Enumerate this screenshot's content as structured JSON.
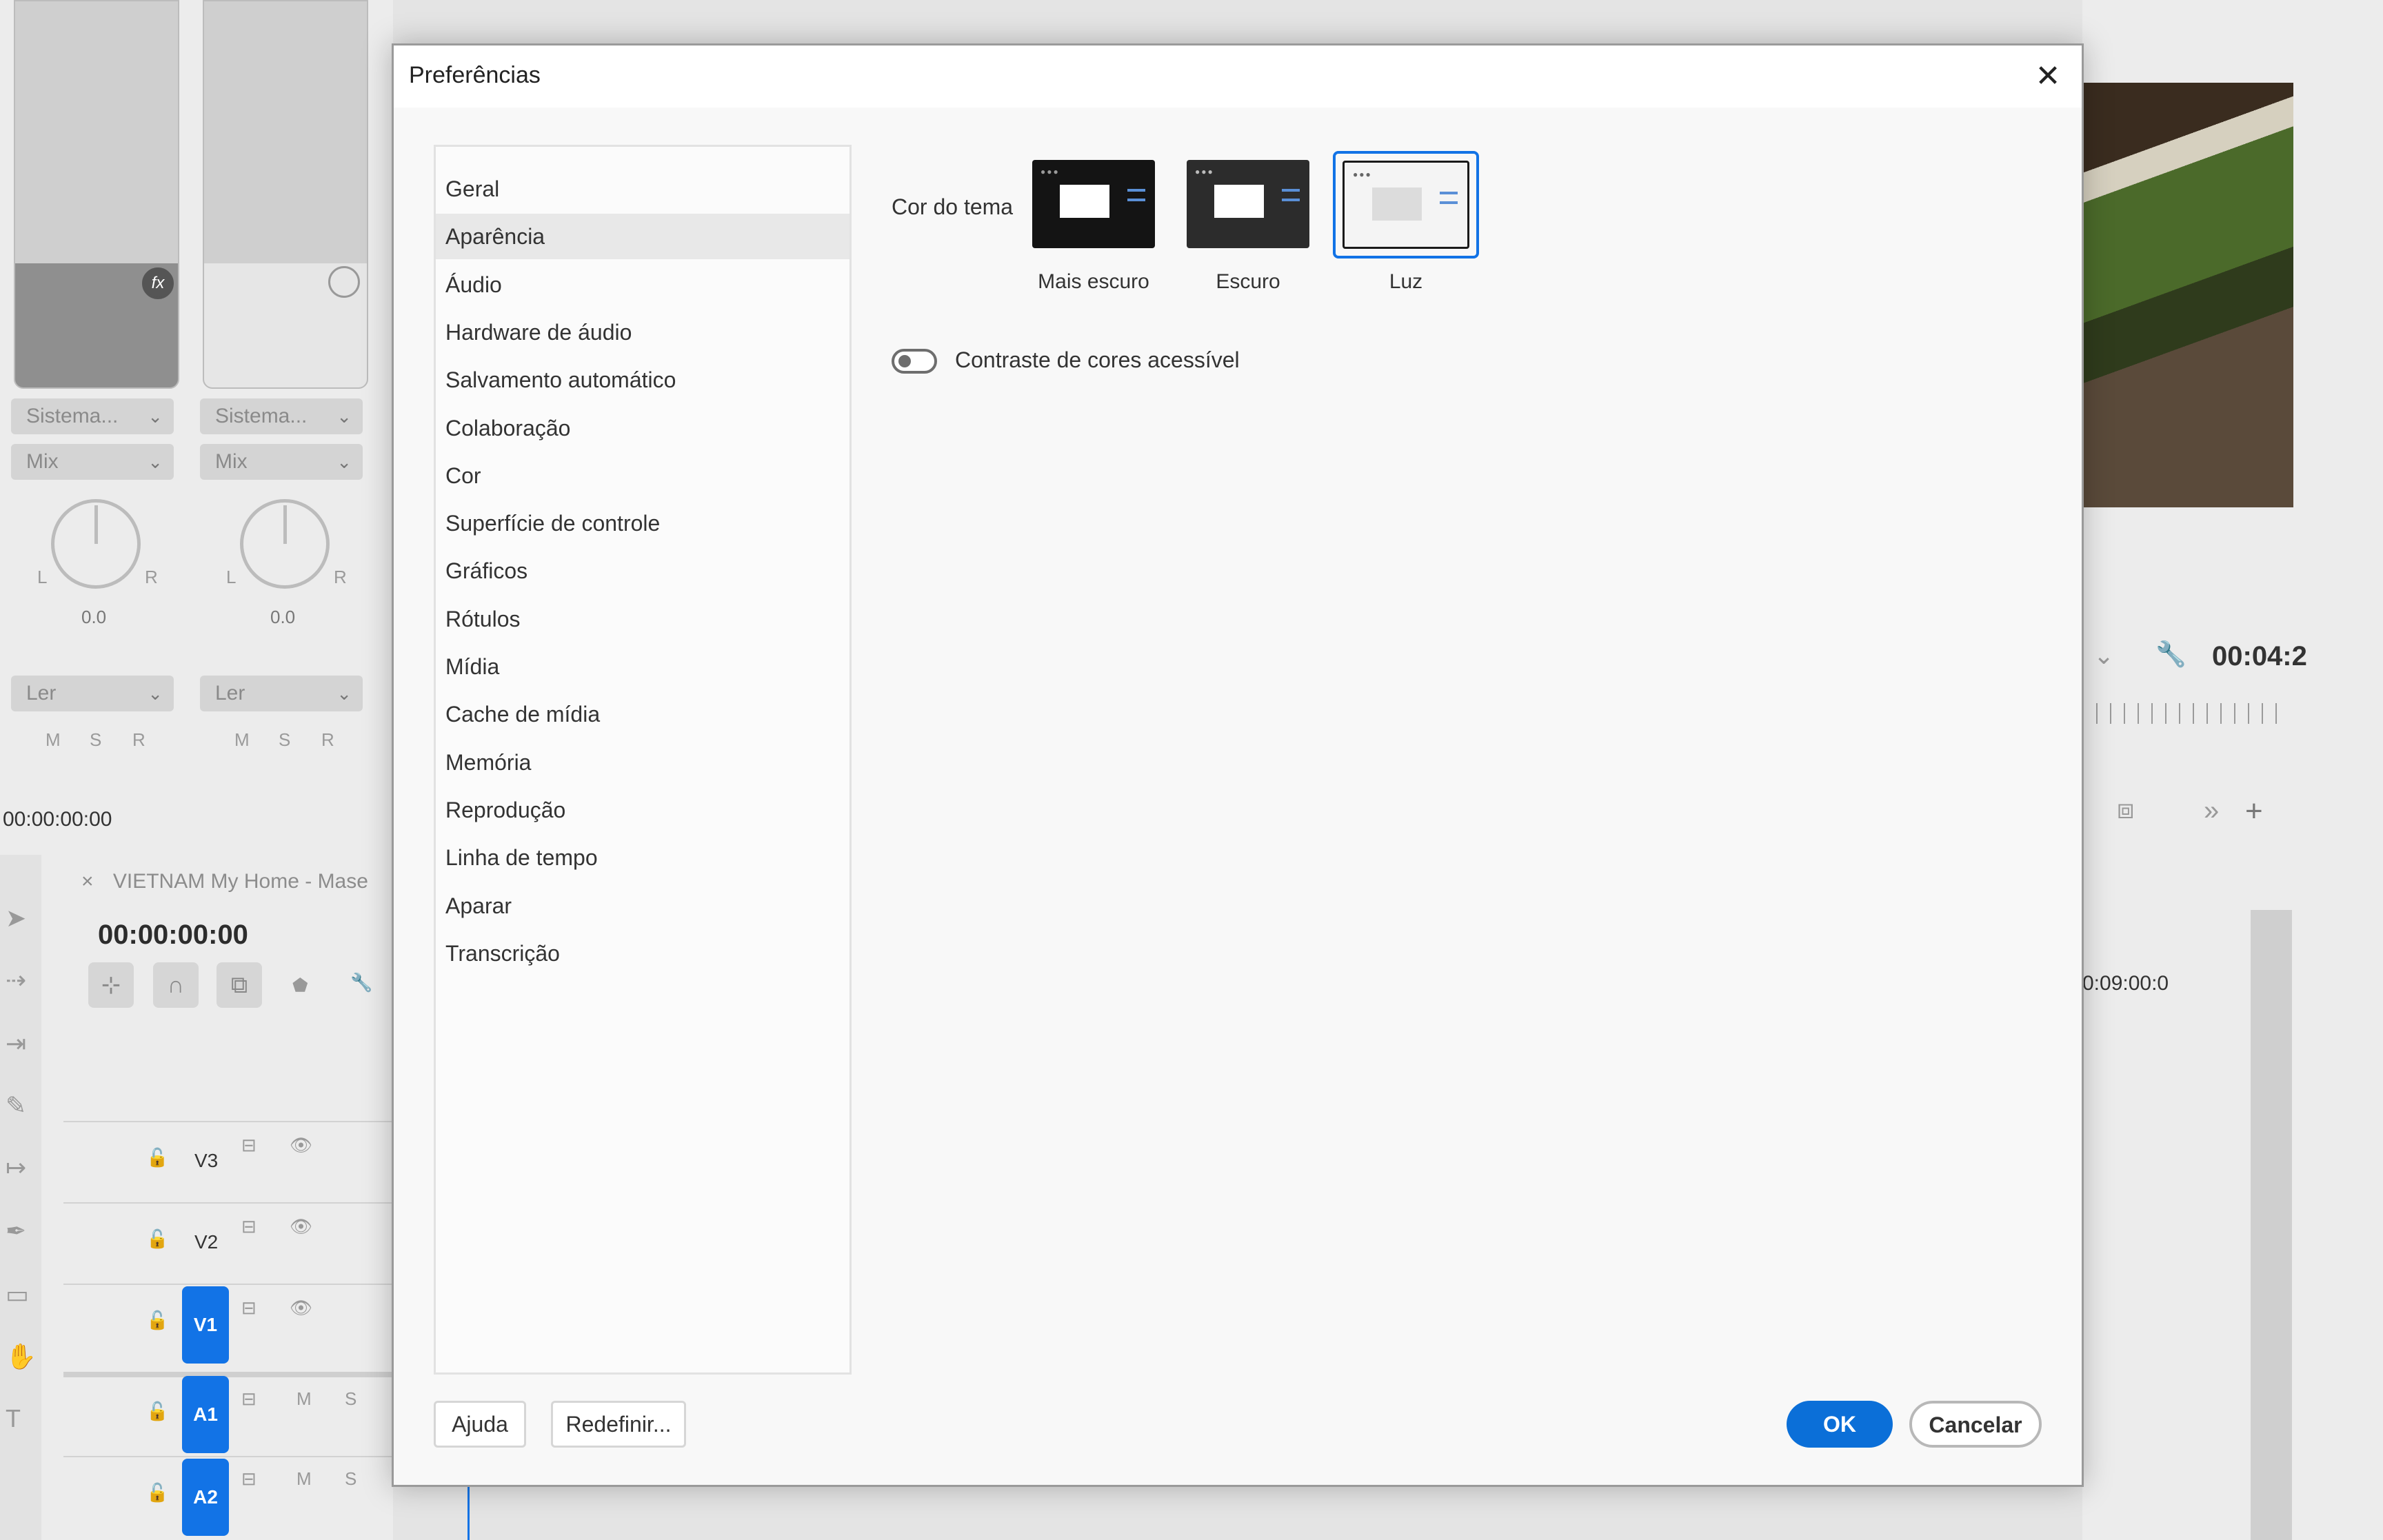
{
  "dialog": {
    "title": "Preferências",
    "nav_items": [
      {
        "label": "Geral"
      },
      {
        "label": "Aparência"
      },
      {
        "label": "Áudio"
      },
      {
        "label": "Hardware de áudio"
      },
      {
        "label": "Salvamento automático"
      },
      {
        "label": "Colaboração"
      },
      {
        "label": "Cor"
      },
      {
        "label": "Superfície de controle"
      },
      {
        "label": "Gráficos"
      },
      {
        "label": "Rótulos"
      },
      {
        "label": "Mídia"
      },
      {
        "label": "Cache de mídia"
      },
      {
        "label": "Memória"
      },
      {
        "label": "Reprodução"
      },
      {
        "label": "Linha de tempo"
      },
      {
        "label": "Aparar"
      },
      {
        "label": "Transcrição"
      }
    ],
    "active_nav": "Aparência",
    "theme_label": "Cor do tema",
    "themes": [
      {
        "label": "Mais escuro"
      },
      {
        "label": "Escuro"
      },
      {
        "label": "Luz"
      }
    ],
    "selected_theme": "Luz",
    "contrast_toggle": {
      "label": "Contraste de cores acessível",
      "on": false
    },
    "buttons": {
      "help": "Ajuda",
      "reset": "Redefinir...",
      "ok": "OK",
      "cancel": "Cancelar"
    }
  },
  "background": {
    "mixer": {
      "channels": [
        {
          "output": "Sistema...",
          "mode": "Mix",
          "pan_value": "0.0",
          "automation": "Ler",
          "pan_l": "L",
          "pan_r": "R",
          "msr": [
            "M",
            "S",
            "R"
          ]
        },
        {
          "output": "Sistema...",
          "mode": "Mix",
          "pan_value": "0.0",
          "automation": "Ler",
          "pan_l": "L",
          "pan_r": "R",
          "msr": [
            "M",
            "S",
            "R"
          ]
        }
      ],
      "timecode": "00:00:00:00"
    },
    "timeline": {
      "tab_close": "×",
      "tab_label": "VIETNAM   My Home - Mase",
      "timecode": "00:00:00:00",
      "tracks": [
        {
          "name": "V3",
          "m": "",
          "s": ""
        },
        {
          "name": "V2",
          "m": "",
          "s": ""
        },
        {
          "name": "V1",
          "m": "",
          "s": ""
        },
        {
          "name": "A1",
          "m": "M",
          "s": "S"
        },
        {
          "name": "A2",
          "m": "M",
          "s": "S"
        }
      ],
      "ruler_time": "0:09:00:0"
    },
    "program_monitor": {
      "timecode": "00:04:2"
    }
  },
  "colors": {
    "accent": "#1273e6",
    "primary_button": "#0b6fd8",
    "dialog_bg": "#f8f8f8",
    "active_nav_bg": "#e8e8e8"
  }
}
